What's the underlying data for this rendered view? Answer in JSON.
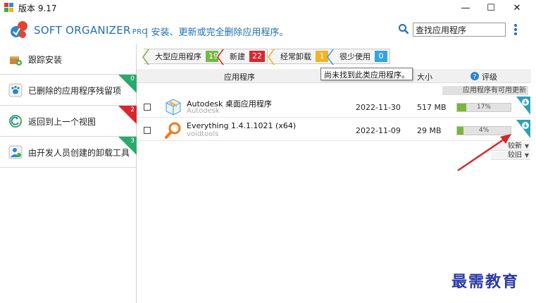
{
  "window": {
    "title": "版本 9.17",
    "minimize": "—",
    "maximize": "☐",
    "close": "✕"
  },
  "header": {
    "brand": "SOFT ORGANIZER",
    "brand_suffix": "PRO",
    "tagline": "| 安装、更新或完全删除应用程序。",
    "search_value": "查找应用程序"
  },
  "sidebar": {
    "items": [
      {
        "label": "跟踪安装",
        "icon": "install-box-icon"
      },
      {
        "label": "已删除的应用程序残留项",
        "icon": "traces-paw-icon",
        "badge": "0",
        "badge_color": "#2aaa6a"
      },
      {
        "label": "返回到上一个视图",
        "icon": "back-view-icon",
        "badge": "2",
        "badge_color": "#d9262e"
      },
      {
        "label": "由开发人员创建的卸载工具",
        "icon": "developer-uninstaller-icon",
        "badge": "3",
        "badge_color": "#2aaa6a"
      }
    ]
  },
  "filters": [
    {
      "label": "大型应用程序",
      "count": "19",
      "color": "#78b844"
    },
    {
      "label": "新建",
      "count": "22",
      "color": "#d9262e"
    },
    {
      "label": "经常卸载",
      "count": "1",
      "color": "#f2b420"
    },
    {
      "label": "很少使用",
      "count": "0",
      "color": "#35a3e0"
    }
  ],
  "table": {
    "columns": {
      "app": "应用程序",
      "size": "大小",
      "rating": "评级"
    },
    "tooltip": "尚未找到此类应用程序。",
    "updates_label": "应用程序有可用更新",
    "rows": [
      {
        "name": "Autodesk 桌面应用程序",
        "publisher": "Autodesk",
        "date": "2022-11-30",
        "size": "517 MB",
        "rating_percent": 17,
        "rating_text": "17%",
        "icon": "autodesk-cube-icon"
      },
      {
        "name": "Everything 1.4.1.1021 (x64)",
        "publisher": "voidtools",
        "date": "2022-11-09",
        "size": "29 MB",
        "rating_percent": 4,
        "rating_text": "4%",
        "icon": "everything-magnifier-icon"
      }
    ],
    "sort_newer": "较新",
    "sort_older": "较旧"
  },
  "watermark": "最需教育",
  "colors": {
    "accent": "#1f6fb5",
    "arrow": "#d6262b"
  }
}
